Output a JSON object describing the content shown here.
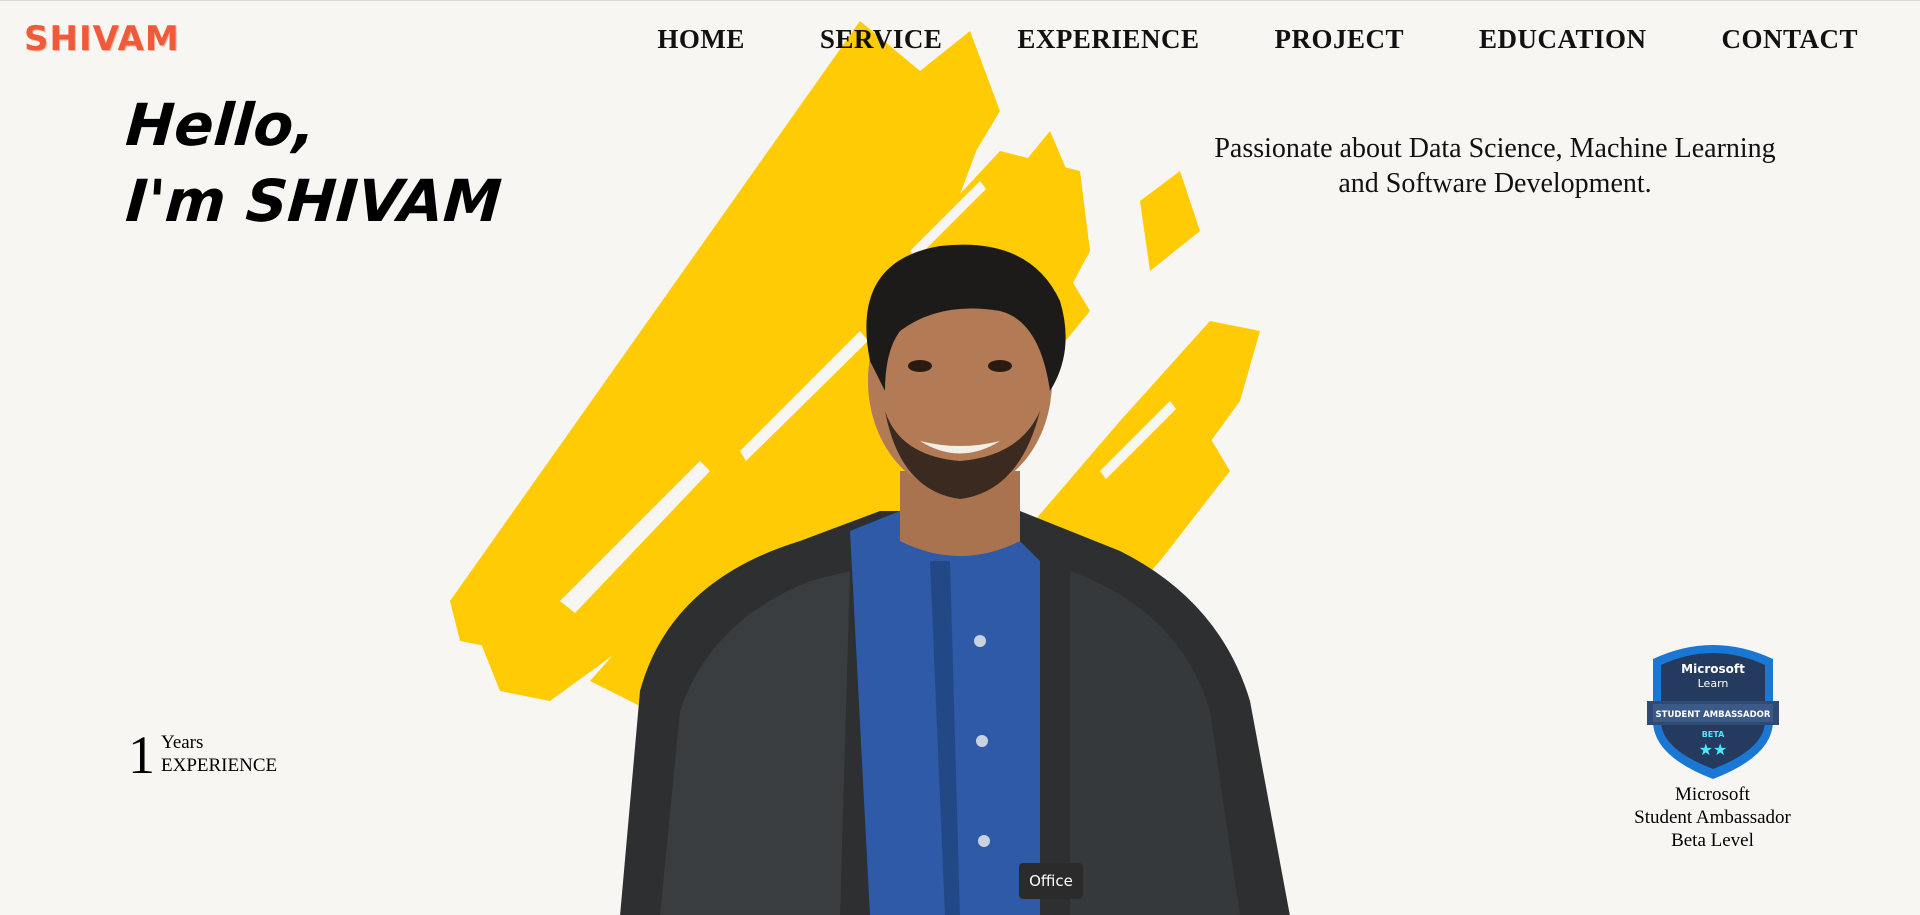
{
  "header": {
    "logo": "SHIVAM",
    "nav": [
      "HOME",
      "SERVICE",
      "EXPERIENCE",
      "PROJECT",
      "EDUCATION",
      "CONTACT"
    ]
  },
  "hero": {
    "greeting_line1": "Hello,",
    "greeting_line2": "I'm SHIVAM",
    "tagline_line1": "Passionate about Data Science, Machine Learning",
    "tagline_line2": "and Software Development."
  },
  "experience": {
    "number": "1",
    "unit": "Years",
    "label": "EXPERIENCE"
  },
  "badge": {
    "brand_line1": "Microsoft",
    "brand_line2": "Learn",
    "ribbon": "STUDENT AMBASSADOR",
    "level_tag": "BETA",
    "stars": 2,
    "caption_line1": "Microsoft",
    "caption_line2": "Student Ambassador",
    "caption_line3": "Beta Level"
  },
  "tooltip": {
    "text": "Office"
  },
  "colors": {
    "background": "#f7f6f2",
    "logo": "#ef5b3a",
    "brush": "#ffcb05",
    "badge_blue": "#1a78d4",
    "badge_navy": "#243a5e",
    "star_cyan": "#50e6ff"
  },
  "icons": [
    "brush-stroke-graphic",
    "portrait-photo",
    "microsoft-learn-badge-icon"
  ]
}
